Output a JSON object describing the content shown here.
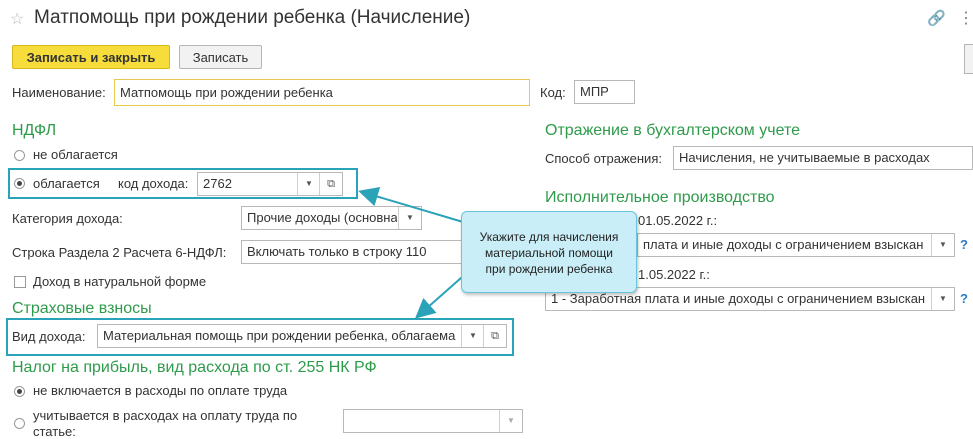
{
  "header": {
    "title": "Матпомощь при рождении ребенка (Начисление)",
    "star_icon": "star-icon",
    "link_icon": "link-icon",
    "menu_icon": "more-vertical-icon"
  },
  "toolbar": {
    "save_close_label": "Записать и закрыть",
    "save_label": "Записать"
  },
  "form": {
    "name_label": "Наименование:",
    "name_value": "Матпомощь при рождении ребенка",
    "code_label": "Код:",
    "code_value": "МПР"
  },
  "ndfl": {
    "section_title": "НДФЛ",
    "not_taxed_label": "не облагается",
    "taxed_label": "облагается",
    "income_code_label": "код дохода:",
    "income_code_value": "2762",
    "income_category_label": "Категория дохода:",
    "income_category_value": "Прочие доходы (основна",
    "line_label": "Строка Раздела 2 Расчета 6-НДФЛ:",
    "line_value": "Включать только в строку 110",
    "in_kind_label": "Доход в натуральной форме"
  },
  "insurance": {
    "section_title": "Страховые взносы",
    "income_type_label": "Вид дохода:",
    "income_type_value": "Материальная помощь при рождении ребенка, облагаема"
  },
  "profit_tax": {
    "section_title": "Налог на прибыль, вид расхода по ст. 255 НК РФ",
    "not_included_label": "не включается в расходы по оплате труда",
    "included_label_line1": "учитывается в расходах на оплату труда по",
    "included_label_line2": "статье:"
  },
  "accounting": {
    "section_title": "Отражение в бухгалтерском учете",
    "method_label": "Способ отражения:",
    "method_value": "Начисления, не учитываемые в расходах"
  },
  "enforcement": {
    "section_title": "Исполнительное производство",
    "before_label": "01.05.2022 г.:",
    "before_value": "плата и иные доходы с ограничением взыскан",
    "after_label": "1.05.2022 г.:",
    "after_value": "1 - Заработная плата и иные доходы с ограничением взыскан",
    "help": "?"
  },
  "callout": {
    "line1": "Укажите для начисления",
    "line2": "материальной помощи",
    "line3": "при рождении ребенка"
  },
  "colors": {
    "section_green": "#2e9b4b",
    "highlight_frame": "#2aa3b8",
    "primary_button": "#f7dd3b",
    "callout_bg": "#c9eef7"
  }
}
